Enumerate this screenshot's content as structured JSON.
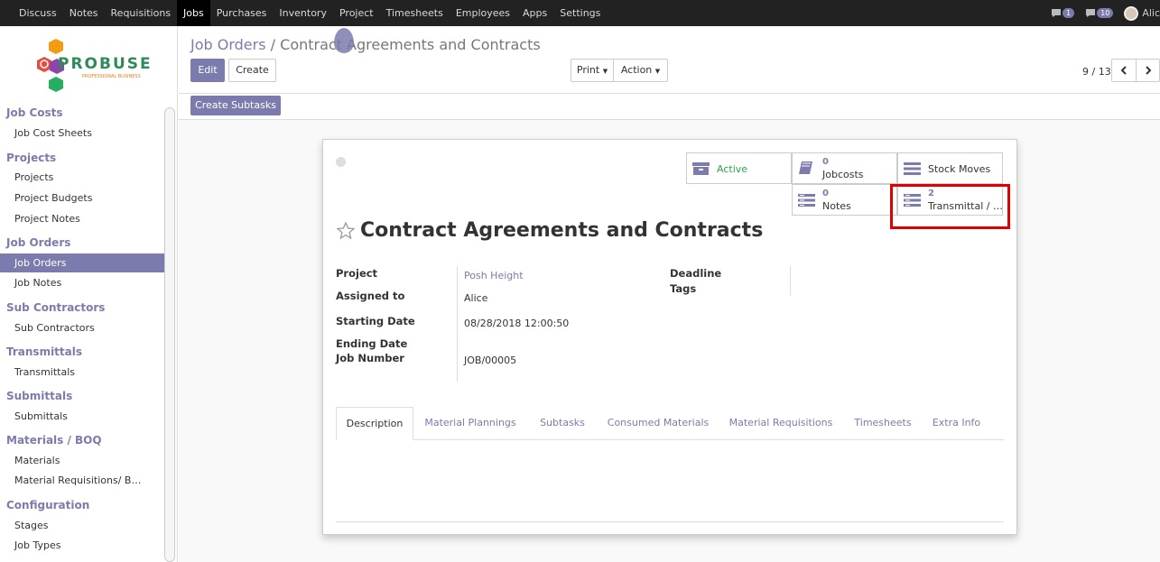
{
  "topbar": {
    "menu": [
      "Discuss",
      "Notes",
      "Requisitions",
      "Jobs",
      "Purchases",
      "Inventory",
      "Project",
      "Timesheets",
      "Employees",
      "Apps",
      "Settings"
    ],
    "active_menu": "Jobs",
    "chat_count": "1",
    "activity_count": "10",
    "user_name": "Alic"
  },
  "logo": {
    "name": "PROBUSE",
    "tagline": "PROFESSIONAL BUSINESS"
  },
  "sidebar": {
    "sections": [
      {
        "title": "Job Costs",
        "items": [
          "Job Cost Sheets"
        ]
      },
      {
        "title": "Projects",
        "items": [
          "Projects",
          "Project Budgets",
          "Project Notes"
        ]
      },
      {
        "title": "Job Orders",
        "items": [
          "Job Orders",
          "Job Notes"
        ]
      },
      {
        "title": "Sub Contractors",
        "items": [
          "Sub Contractors"
        ]
      },
      {
        "title": "Transmittals",
        "items": [
          "Transmittals"
        ]
      },
      {
        "title": "Submittals",
        "items": [
          "Submittals"
        ]
      },
      {
        "title": "Materials / BOQ",
        "items": [
          "Materials",
          "Material Requisitions/ B…"
        ]
      },
      {
        "title": "Configuration",
        "items": [
          "Stages",
          "Job Types"
        ]
      }
    ],
    "active_item": "Job Orders"
  },
  "breadcrumb": {
    "parent": "Job Orders",
    "separator": "/",
    "current": "Contract Agreements and Contracts"
  },
  "buttons": {
    "edit": "Edit",
    "create": "Create",
    "print": "Print",
    "action": "Action",
    "create_subtasks": "Create Subtasks"
  },
  "pager": {
    "value": "9 / 13"
  },
  "stat_buttons": {
    "active": "Active",
    "jobcosts": {
      "count": "0",
      "label": "Jobcosts"
    },
    "stock_moves": "Stock Moves",
    "notes": {
      "count": "0",
      "label": "Notes"
    },
    "transmittal": {
      "count": "2",
      "label": "Transmittal / …"
    }
  },
  "record": {
    "title": "Contract Agreements and Contracts",
    "fields": {
      "project_label": "Project",
      "project_value": "Posh Height",
      "assigned_label": "Assigned to",
      "assigned_value": "Alice",
      "start_label": "Starting Date",
      "start_value": "08/28/2018 12:00:50",
      "end_label": "Ending Date",
      "jobnum_label": "Job Number",
      "jobnum_value": "JOB/00005",
      "deadline_label": "Deadline",
      "tags_label": "Tags"
    }
  },
  "tabs": [
    "Description",
    "Material Plannings",
    "Subtasks",
    "Consumed Materials",
    "Material Requisitions",
    "Timesheets",
    "Extra Info"
  ],
  "colors": {
    "accent": "#7c7bad",
    "highlight": "#e00000",
    "active_green": "#28a745",
    "topbar": "#222222"
  }
}
